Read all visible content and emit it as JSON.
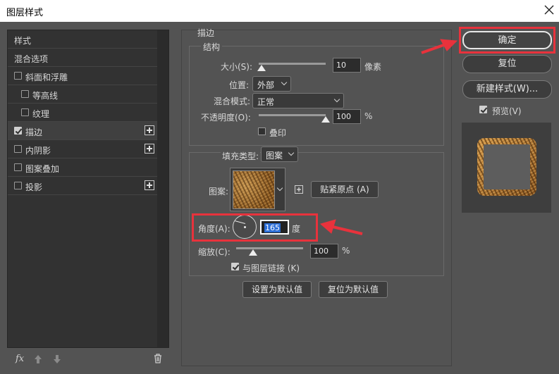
{
  "window": {
    "title": "图层样式"
  },
  "left_list": {
    "items": [
      {
        "label": "样式",
        "has_checkbox": false,
        "checked": false,
        "has_plus": false
      },
      {
        "label": "混合选项",
        "has_checkbox": false,
        "checked": false,
        "has_plus": false
      },
      {
        "label": "斜面和浮雕",
        "has_checkbox": true,
        "checked": false,
        "has_plus": false
      },
      {
        "label": "等高线",
        "has_checkbox": true,
        "checked": false,
        "has_plus": false
      },
      {
        "label": "纹理",
        "has_checkbox": true,
        "checked": false,
        "has_plus": false
      },
      {
        "label": "描边",
        "has_checkbox": true,
        "checked": true,
        "has_plus": true
      },
      {
        "label": "内阴影",
        "has_checkbox": true,
        "checked": false,
        "has_plus": true
      },
      {
        "label": "图案叠加",
        "has_checkbox": true,
        "checked": false,
        "has_plus": false
      },
      {
        "label": "投影",
        "has_checkbox": true,
        "checked": false,
        "has_plus": true
      }
    ],
    "fx_label": "fx"
  },
  "stroke": {
    "section_title": "描边",
    "structure_title": "结构",
    "size_label": "大小(S):",
    "size_value": "10",
    "size_unit": "像素",
    "size_fraction": 0.04,
    "position_label": "位置:",
    "position_value": "外部",
    "blend_label": "混合模式:",
    "blend_value": "正常",
    "opacity_label": "不透明度(O):",
    "opacity_value": "100",
    "opacity_unit": "%",
    "opacity_fraction": 1.0,
    "overprint_label": "叠印",
    "overprint_checked": false,
    "fill_type_label": "填充类型:",
    "fill_type_value": "图案",
    "pattern_label": "图案:",
    "snap_origin_button": "贴紧原点 (A)",
    "angle_label": "角度(A):",
    "angle_value": "165",
    "angle_unit": "度",
    "scale_label": "缩放(C):",
    "scale_value": "100",
    "scale_unit": "%",
    "scale_fraction": 0.25,
    "link_label": "与图层链接 (K)",
    "link_checked": true,
    "set_default_button": "设置为默认值",
    "reset_default_button": "复位为默认值"
  },
  "right_panel": {
    "ok_button": "确定",
    "reset_button": "复位",
    "new_style_button": "新建样式(W)...",
    "preview_label": "预览(V)",
    "preview_checked": true
  },
  "colors": {
    "annotation_red": "#e8323c",
    "selection_blue": "#2c6ed6",
    "pattern_brown": "#b07a38"
  }
}
